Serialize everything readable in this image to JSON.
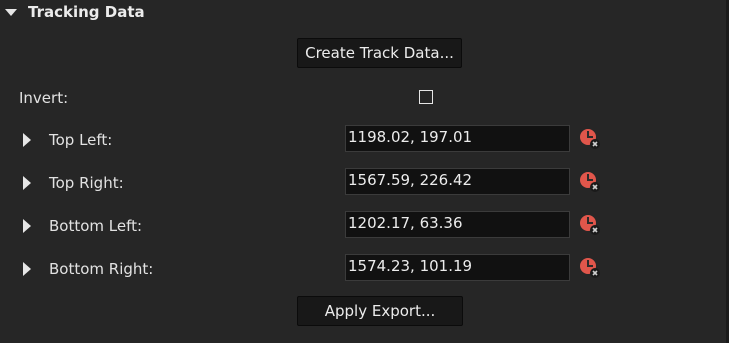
{
  "section": {
    "title": "Tracking Data",
    "icon": "triangle-down-icon"
  },
  "create_button": {
    "label": "Create Track Data..."
  },
  "invert": {
    "label": "Invert:",
    "checked": false
  },
  "points": [
    {
      "label": "Top Left:",
      "value": "1198.02, 197.01"
    },
    {
      "label": "Top Right:",
      "value": "1567.59, 226.42"
    },
    {
      "label": "Bottom Left:",
      "value": "1202.17, 63.36"
    },
    {
      "label": "Bottom Right:",
      "value": "1574.23, 101.19"
    }
  ],
  "apply_button": {
    "label": "Apply Export..."
  },
  "colors": {
    "background": "#262626",
    "field_bg": "#111111",
    "accent_red": "#e0564b"
  }
}
